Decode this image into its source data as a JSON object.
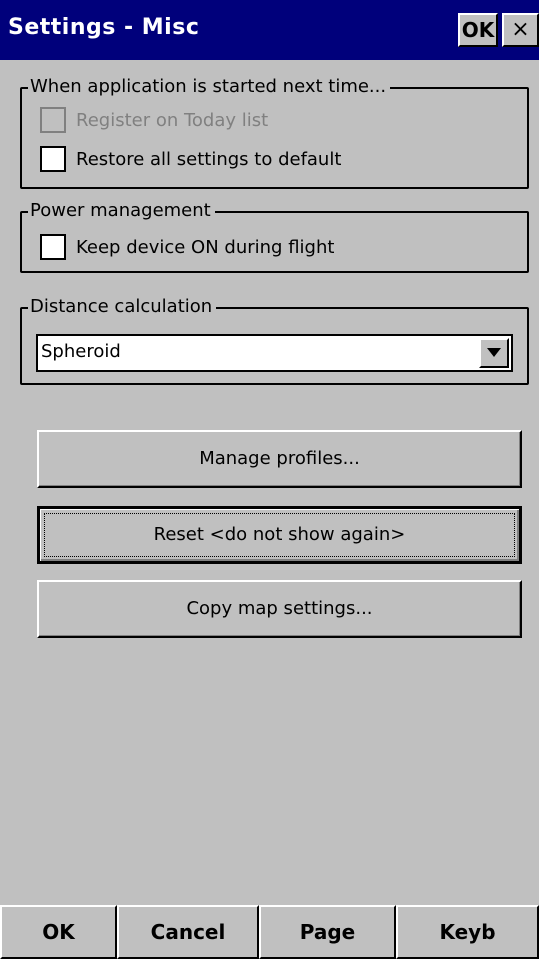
{
  "window": {
    "title": "Settings - Misc",
    "ok_label": "OK",
    "close_label": "×"
  },
  "startup_group": {
    "label": "When application is started next time...",
    "register_today": {
      "label": "Register on Today list",
      "checked": false,
      "enabled": false
    },
    "restore_defaults": {
      "label": "Restore all settings to default",
      "checked": false,
      "enabled": true
    }
  },
  "power_group": {
    "label": "Power management",
    "keep_on": {
      "label": "Keep device ON during flight",
      "checked": false
    }
  },
  "distance_group": {
    "label": "Distance calculation",
    "selected": "Spheroid"
  },
  "buttons": {
    "manage_profiles": "Manage profiles...",
    "reset": "Reset <do not show again>",
    "copy_map": "Copy map settings..."
  },
  "softkeys": {
    "ok": "OK",
    "cancel": "Cancel",
    "page": "Page",
    "keyb": "Keyb"
  },
  "colors": {
    "titlebar": "#00007b",
    "face": "#c0c0c0",
    "disabled_text": "#808080"
  }
}
